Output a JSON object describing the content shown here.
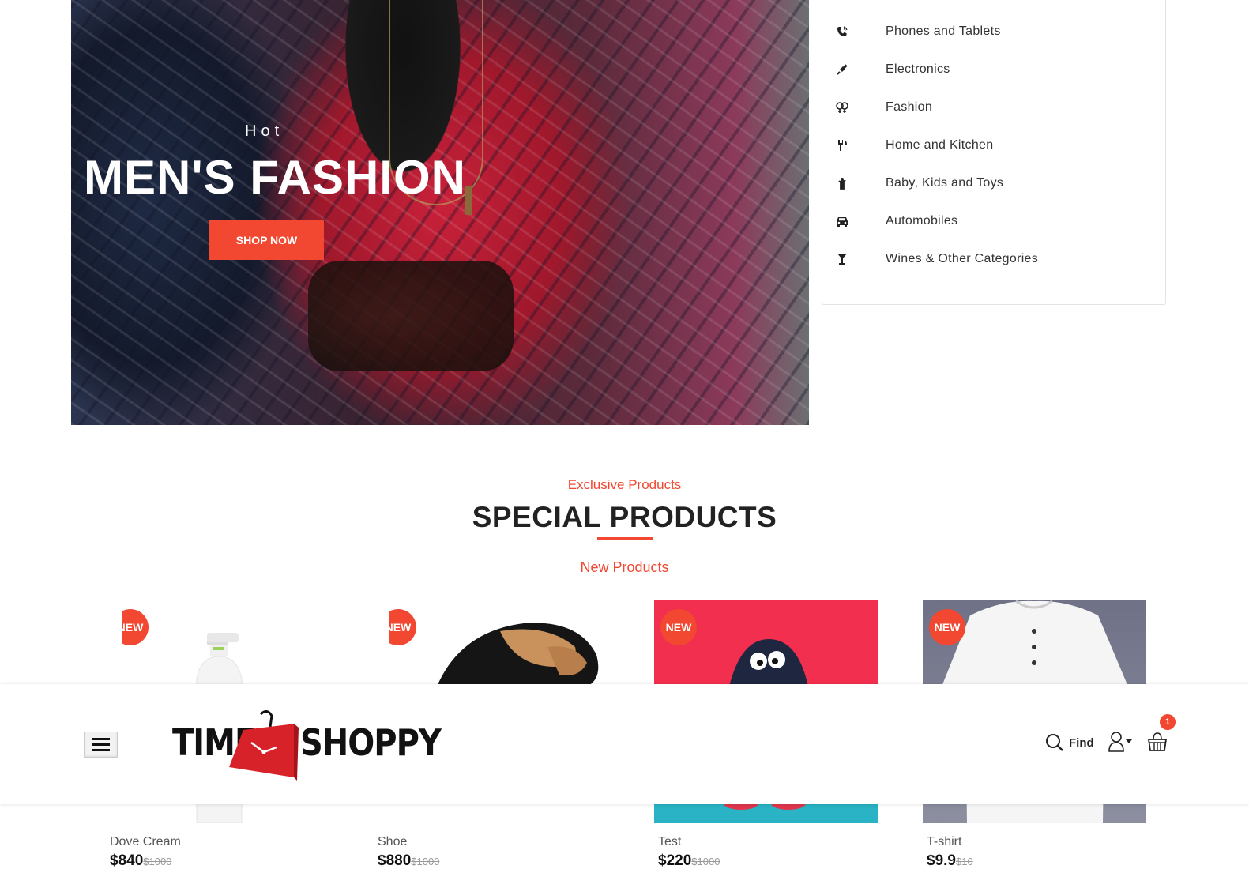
{
  "hero": {
    "kicker": "Hot",
    "title": "MEN'S FASHION",
    "button_label": "SHOP NOW"
  },
  "categories": [
    {
      "label": "Phones and Tablets",
      "icon": "phone-icon"
    },
    {
      "label": "Electronics",
      "icon": "plug-icon"
    },
    {
      "label": "Fashion",
      "icon": "gender-icon"
    },
    {
      "label": "Home and Kitchen",
      "icon": "cutlery-icon"
    },
    {
      "label": "Baby, Kids and Toys",
      "icon": "child-icon"
    },
    {
      "label": "Automobiles",
      "icon": "car-icon"
    },
    {
      "label": "Wines & Other Categories",
      "icon": "glass-icon"
    }
  ],
  "section": {
    "kicker": "Exclusive Products",
    "title": "SPECIAL PRODUCTS",
    "tab": "New Products"
  },
  "products": [
    {
      "badge": "NEW",
      "name": "Dove Cream",
      "price": "$840",
      "old_price": "$1000"
    },
    {
      "badge": "NEW",
      "name": "Shoe",
      "price": "$880",
      "old_price": "$1000"
    },
    {
      "badge": "NEW",
      "name": "Test",
      "price": "$220",
      "old_price": "$1000"
    },
    {
      "badge": "NEW",
      "name": "T-shirt",
      "price": "$9.9",
      "old_price": "$10"
    }
  ],
  "header": {
    "logo_left": "TIME",
    "logo_right": "SHOPPY",
    "find_label": "Find",
    "cart_count": "1"
  },
  "colors": {
    "accent": "#f24731"
  }
}
